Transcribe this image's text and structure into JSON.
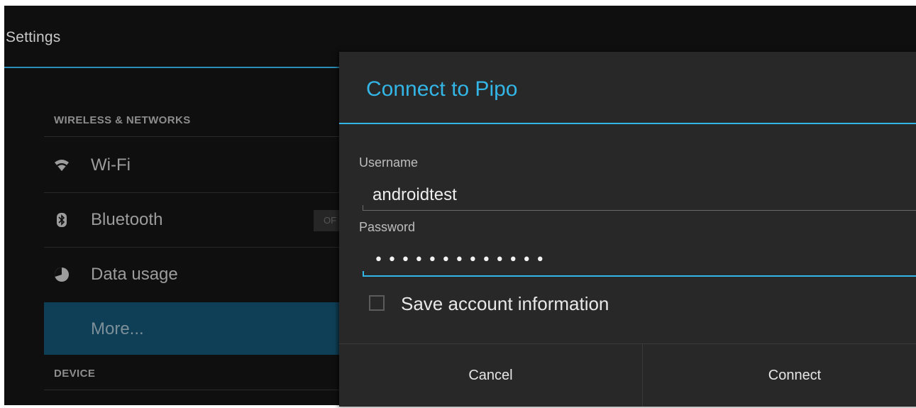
{
  "app": {
    "title": "Settings"
  },
  "settings": {
    "section_wireless": "WIRELESS & NETWORKS",
    "section_device": "DEVICE",
    "items": [
      {
        "label": "Wi-Fi",
        "icon": "wifi-icon"
      },
      {
        "label": "Bluetooth",
        "icon": "bluetooth-icon",
        "toggle": "OF"
      },
      {
        "label": "Data usage",
        "icon": "data-usage-icon"
      },
      {
        "label": "More...",
        "selected": true
      }
    ]
  },
  "dialog": {
    "title": "Connect to Pipo",
    "username_label": "Username",
    "username_value": "androidtest",
    "password_label": "Password",
    "password_masked": "•••••••••••••",
    "save_label": "Save account information",
    "save_checked": false,
    "cancel_label": "Cancel",
    "connect_label": "Connect"
  },
  "colors": {
    "accent": "#33b5e5",
    "background": "#0f0f10",
    "dialog": "#282828",
    "selected_row": "#0f3f57"
  }
}
